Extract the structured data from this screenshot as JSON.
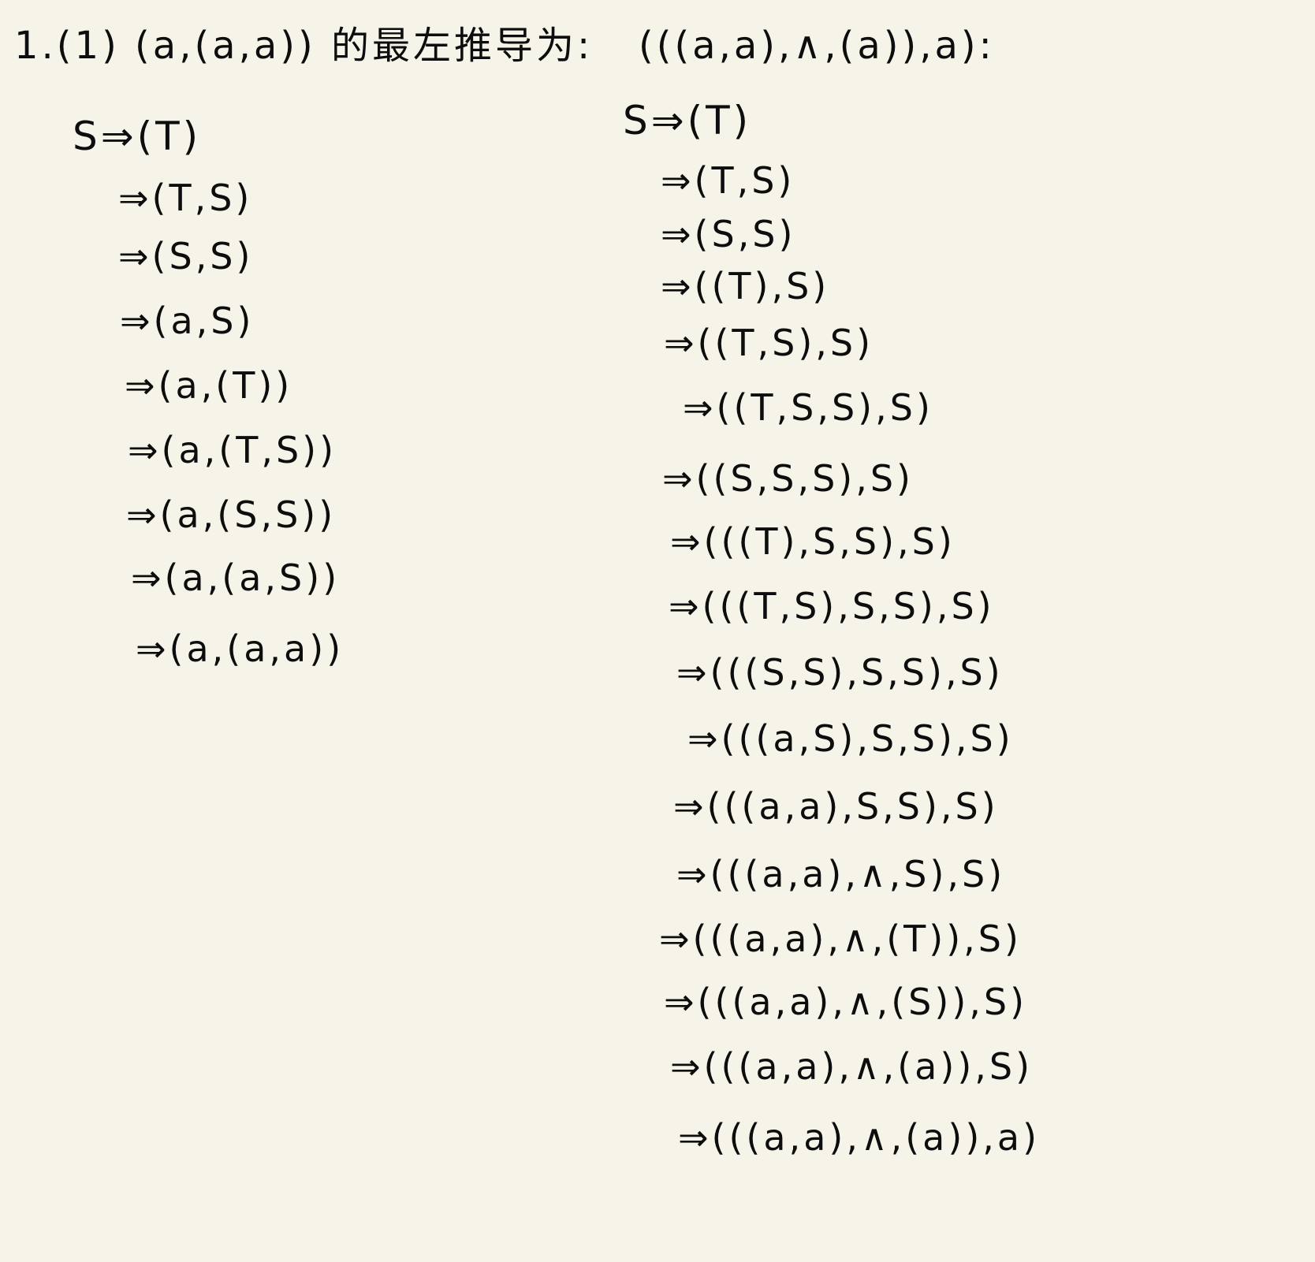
{
  "left": {
    "heading": "1.(1) (a,(a,a)) 的最左推导为:",
    "lines": [
      "S⇒(T)",
      "⇒(T,S)",
      "⇒(S,S)",
      "⇒(a,S)",
      "⇒(a,(T))",
      "⇒(a,(T,S))",
      "⇒(a,(S,S))",
      "⇒(a,(a,S))",
      "⇒(a,(a,a))"
    ]
  },
  "right": {
    "heading": "(((a,a),∧,(a)),a):",
    "lines": [
      "S⇒(T)",
      "⇒(T,S)",
      "⇒(S,S)",
      "⇒((T),S)",
      "⇒((T,S),S)",
      "⇒((T,S,S),S)",
      "⇒((S,S,S),S)",
      "⇒(((T),S,S),S)",
      "⇒(((T,S),S,S),S)",
      "⇒(((S,S),S,S),S)",
      "⇒(((a,S),S,S),S)",
      "⇒(((a,a),S,S),S)",
      "⇒(((a,a),∧,S),S)",
      "⇒(((a,a),∧,(T)),S)",
      "⇒(((a,a),∧,(S)),S)",
      "⇒(((a,a),∧,(a)),S)",
      "⇒(((a,a),∧,(a)),a)"
    ]
  }
}
